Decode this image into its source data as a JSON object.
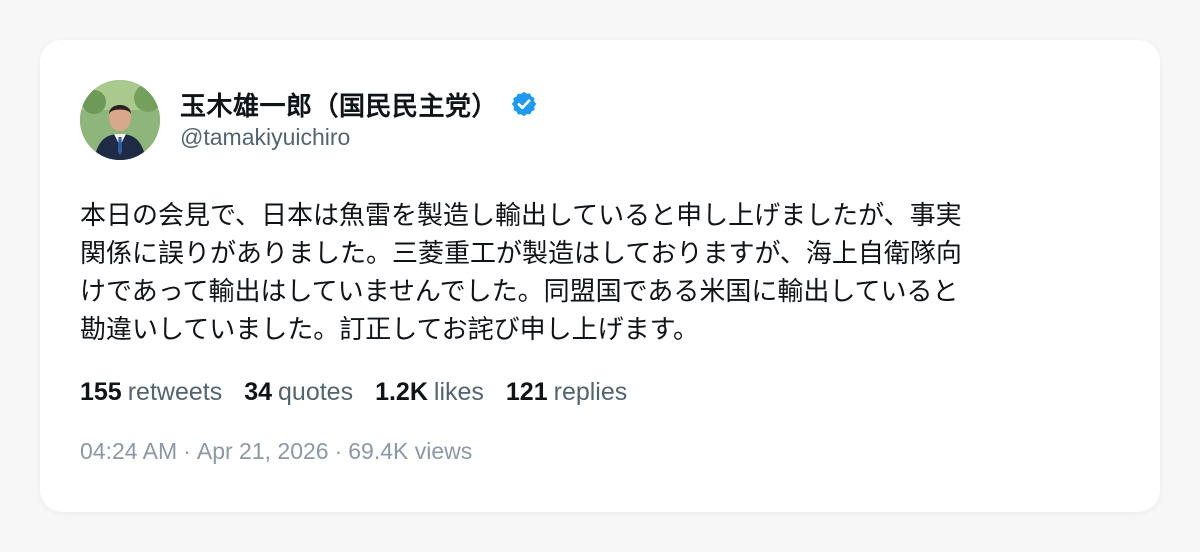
{
  "author": {
    "display_name": "玉木雄一郎（国民民主党）",
    "handle": "@tamakiyuichiro",
    "verified_icon": "verified-badge-icon",
    "verified_color": "#1d9bf0"
  },
  "tweet": {
    "lines": [
      "本日の会見で、日本は魚雷を製造し輸出していると申し上げましたが、事実",
      "関係に誤りがありました。三菱重工が製造はしておりますが、海上自衛隊向",
      "けであって輸出はしていませんでした。同盟国である米国に輸出していると",
      "勘違いしていました。訂正してお詫び申し上げます。"
    ]
  },
  "stats": {
    "retweets": {
      "count": "155",
      "label": "retweets"
    },
    "quotes": {
      "count": "34",
      "label": "quotes"
    },
    "likes": {
      "count": "1.2K",
      "label": "likes"
    },
    "replies": {
      "count": "121",
      "label": "replies"
    }
  },
  "meta": {
    "time": "04:24 AM",
    "separator": "·",
    "date": "Apr 21, 2026",
    "views": "69.4K views"
  },
  "colors": {
    "text": "#0f1419",
    "secondary": "#536471",
    "muted": "#8b98a5",
    "card_bg": "#ffffff",
    "page_bg": "#f7f7f8"
  }
}
